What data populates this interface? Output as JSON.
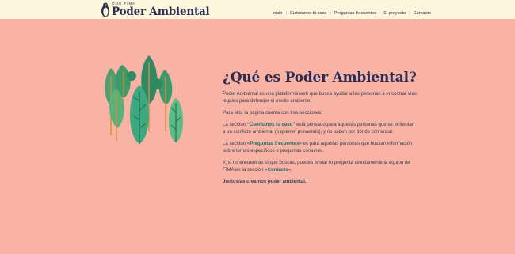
{
  "header": {
    "org_small": "ONG FIMA",
    "org_name": "Poder Ambiental",
    "nav": [
      {
        "label": "Inicio"
      },
      {
        "label": "Cuéntanos tu caso"
      },
      {
        "label": "Preguntas frecuentes"
      },
      {
        "label": "El proyecto"
      },
      {
        "label": "Contacto"
      }
    ]
  },
  "main": {
    "title": "¿Qué es Poder Ambiental?",
    "p1": "Poder Ambiental es una plataforma web que busca ayudar a las personas a encontrar vías legales para defender el medio ambiente.",
    "p2": "Para ello, la página cuenta con tres secciones:",
    "p3_pre": "La sección ",
    "p3_link": "“Cuéntanos tu caso”",
    "p3_post": " está pensado para aquellas personas que se enfrentan a un conflicto ambiental (o quieren prevenirlo), y no saben por dónde comenzar.",
    "p4_pre": "La sección «",
    "p4_link": "Preguntas frecuentes",
    "p4_post": "» es para aquellas personas que buscan información sobre temas específicos o preguntas comunes.",
    "p5_pre": "Y, si no encuentras lo que buscas, puedes enviar tu pregunta directamente al equipo de FIMA en la sección «",
    "p5_link": "Contacto",
    "p5_post": "».",
    "p6": "Juntos/as creamos poder ambiental."
  },
  "colors": {
    "background": "#f9b3a4",
    "header_bg": "#fcf6dc",
    "accent_green": "#1f6b5b",
    "title_navy": "#2b2d55"
  },
  "icons": {
    "logo": "penguin-logo-icon",
    "illustration": "trees-illustration"
  }
}
